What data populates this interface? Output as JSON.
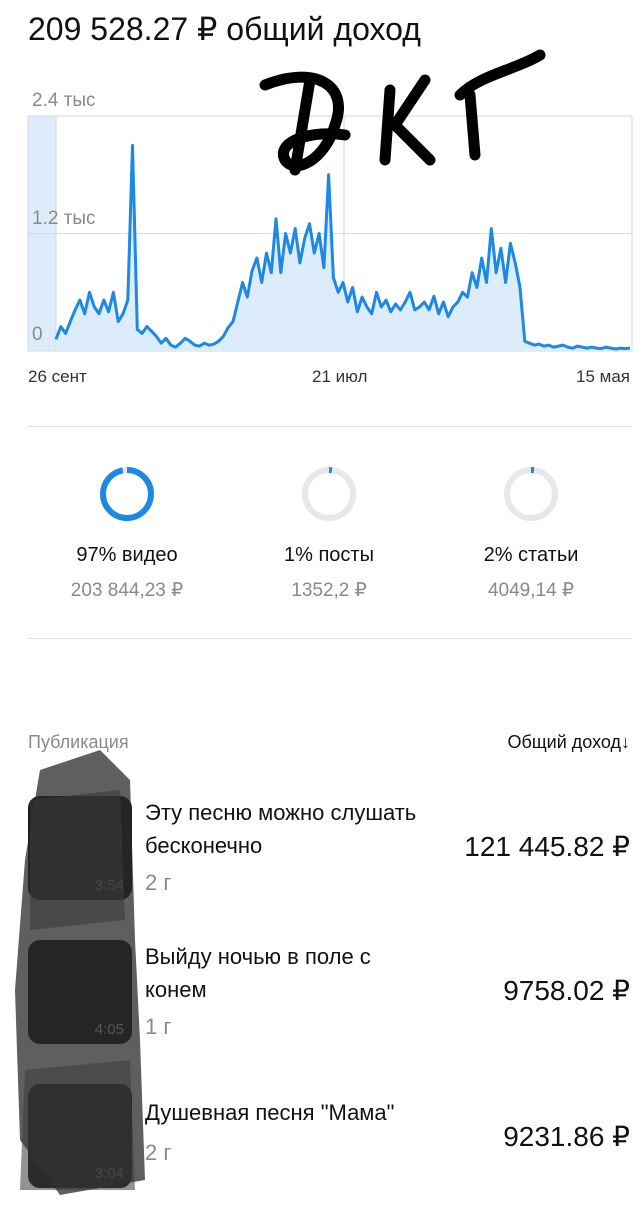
{
  "header": {
    "total_income": "209 528.27 ₽ общий доход"
  },
  "chart_data": {
    "type": "area",
    "y_ticks": [
      "2.4 тыс",
      "1.2 тыс",
      "0"
    ],
    "x_ticks": [
      "26 сент",
      "21 июл",
      "15 мая"
    ],
    "ylim": [
      0,
      2400
    ],
    "grid": true,
    "color": "#1e88e5",
    "fill_color": "#dcecfa",
    "values": [
      120,
      250,
      180,
      300,
      420,
      520,
      380,
      600,
      450,
      380,
      520,
      400,
      600,
      300,
      380,
      520,
      2100,
      220,
      180,
      250,
      200,
      150,
      80,
      130,
      60,
      40,
      80,
      130,
      100,
      60,
      50,
      80,
      60,
      70,
      100,
      150,
      240,
      300,
      500,
      700,
      550,
      820,
      950,
      700,
      1000,
      800,
      1350,
      800,
      1200,
      1000,
      1250,
      900,
      1150,
      1300,
      1000,
      1200,
      850,
      1800,
      750,
      600,
      700,
      500,
      650,
      400,
      550,
      450,
      380,
      600,
      450,
      520,
      400,
      480,
      420,
      500,
      600,
      420,
      450,
      500,
      420,
      560,
      380,
      500,
      350,
      450,
      500,
      600,
      550,
      800,
      650,
      950,
      700,
      1250,
      800,
      1050,
      700,
      1100,
      900,
      650,
      100,
      80,
      60,
      70,
      50,
      60,
      40,
      50,
      60,
      40,
      30,
      50,
      40,
      30,
      40,
      30,
      25,
      40,
      30,
      20,
      30,
      25,
      30
    ]
  },
  "stats": [
    {
      "label": "97% видео",
      "amount": "203 844,23 ₽",
      "fraction": 0.97
    },
    {
      "label": "1% посты",
      "amount": "1352,2 ₽",
      "fraction": 0.01
    },
    {
      "label": "2% статьи",
      "amount": "4049,14 ₽",
      "fraction": 0.02
    }
  ],
  "table": {
    "col_publication": "Публикация",
    "col_income": "Общий доход",
    "sort_icon": "arrow-down-icon"
  },
  "publications": [
    {
      "title": "Эту песню можно слушать бесконечно",
      "age": "2 г",
      "income": "121 445.82 ₽",
      "duration": "3:54"
    },
    {
      "title": "Выйду ночью в поле с конем",
      "age": "1 г",
      "income": "9758.02 ₽",
      "duration": "4:05"
    },
    {
      "title": "Душевная песня \"Мама\"",
      "age": "2 г",
      "income": "9231.86 ₽",
      "duration": "3:04"
    }
  ],
  "colors": {
    "accent": "#1e88e5",
    "ring_track": "#e8e8e8",
    "muted": "#8a8a8a"
  }
}
